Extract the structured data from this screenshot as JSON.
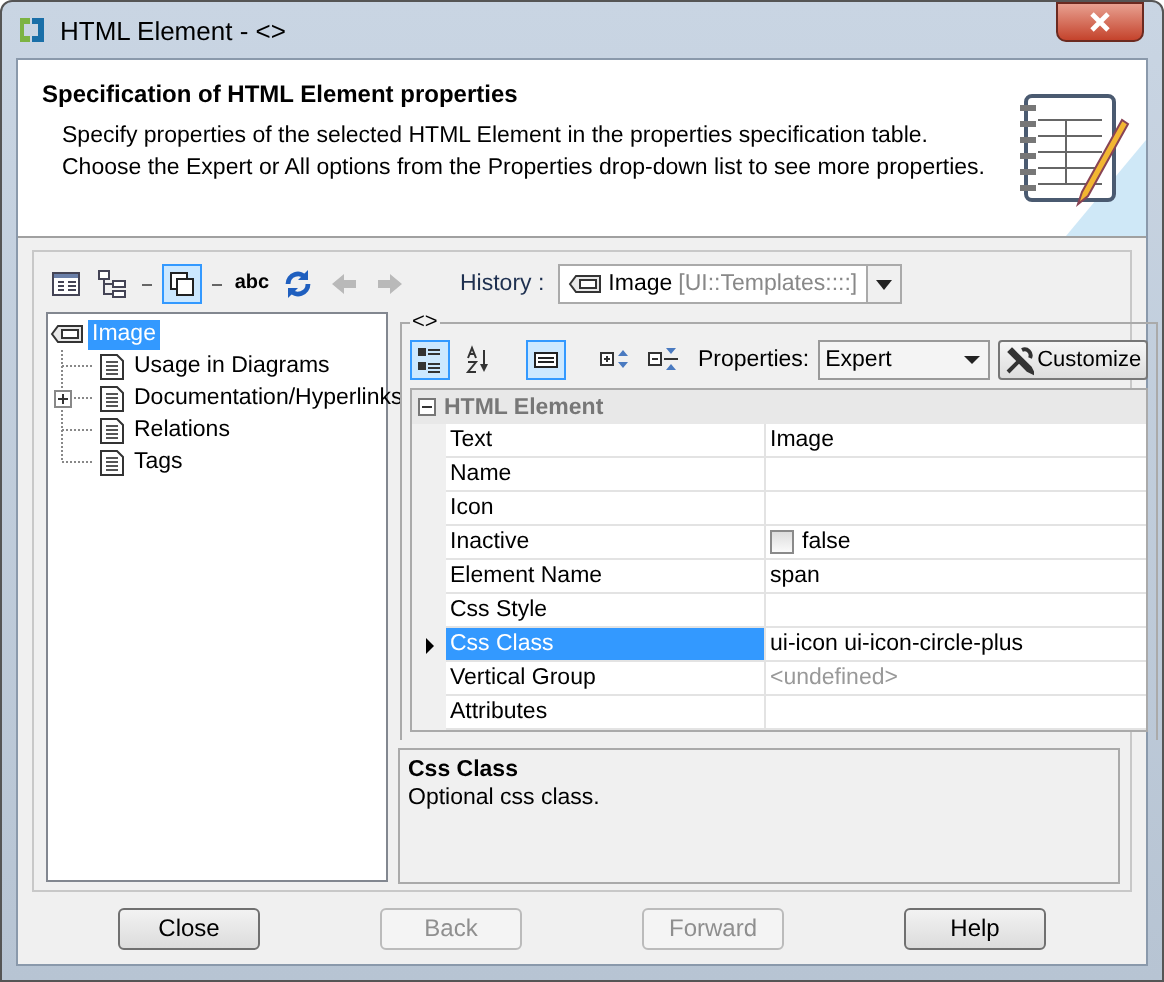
{
  "window": {
    "title": "HTML Element - <>"
  },
  "header": {
    "title": "Specification of HTML Element properties",
    "description": "Specify properties of the selected HTML Element in the properties specification table. Choose the Expert or All options from the Properties drop-down list to see more properties."
  },
  "toolbar": {
    "tools": [
      {
        "kind": "table",
        "on": false,
        "disabled": false
      },
      {
        "kind": "tree",
        "on": false,
        "disabled": false
      },
      {
        "kind": "sep"
      },
      {
        "kind": "copy",
        "on": true,
        "disabled": false
      },
      {
        "kind": "sep"
      },
      {
        "kind": "spell",
        "label": "abc",
        "on": false,
        "disabled": false
      },
      {
        "kind": "refresh",
        "on": false,
        "disabled": false
      },
      {
        "kind": "back",
        "on": false,
        "disabled": true
      },
      {
        "kind": "forward",
        "on": false,
        "disabled": true
      }
    ],
    "history_label": "History :",
    "history_name": "Image",
    "history_path": "[UI::Templates::::]"
  },
  "tree": {
    "label": "Image",
    "selected": true,
    "children": [
      {
        "label": "Usage in Diagrams",
        "expandable": false
      },
      {
        "label": "Documentation/Hyperlinks",
        "expandable": true
      },
      {
        "label": "Relations",
        "expandable": false
      },
      {
        "label": "Tags",
        "expandable": false
      }
    ]
  },
  "panel": {
    "title": "<>",
    "tools": [
      {
        "kind": "categorized",
        "on": true
      },
      {
        "kind": "sort",
        "on": false
      },
      {
        "kind": "description",
        "on": true
      },
      {
        "kind": "expand",
        "on": false
      },
      {
        "kind": "collapse",
        "on": false
      }
    ],
    "properties_label": "Properties:",
    "properties_value": "Expert",
    "customize": "Customize",
    "group": {
      "label": "HTML Element",
      "expanded": true
    },
    "rows": [
      {
        "name": "Text",
        "kind": "text",
        "value": "Image",
        "selected": false
      },
      {
        "name": "Name",
        "kind": "text",
        "selected": false
      },
      {
        "name": "Icon",
        "kind": "text",
        "selected": false
      },
      {
        "name": "Inactive",
        "kind": "checkbox",
        "checked": false,
        "value": "false",
        "selected": false
      },
      {
        "name": "Element Name",
        "kind": "text",
        "value": "span",
        "selected": false
      },
      {
        "name": "Css Style",
        "kind": "text",
        "selected": false
      },
      {
        "name": "Css Class",
        "kind": "text",
        "value": "ui-icon ui-icon-circle-plus",
        "selected": true
      },
      {
        "name": "Vertical Group",
        "kind": "unset",
        "value": "<undefined>",
        "selected": false
      },
      {
        "name": "Attributes",
        "kind": "text",
        "selected": false
      }
    ],
    "description": {
      "title": "Css Class",
      "text": "Optional css class."
    }
  },
  "buttons": [
    {
      "label": "Close",
      "disabled": false
    },
    {
      "label": "Back",
      "disabled": true
    },
    {
      "label": "Forward",
      "disabled": true
    },
    {
      "label": "Help",
      "disabled": false
    }
  ]
}
